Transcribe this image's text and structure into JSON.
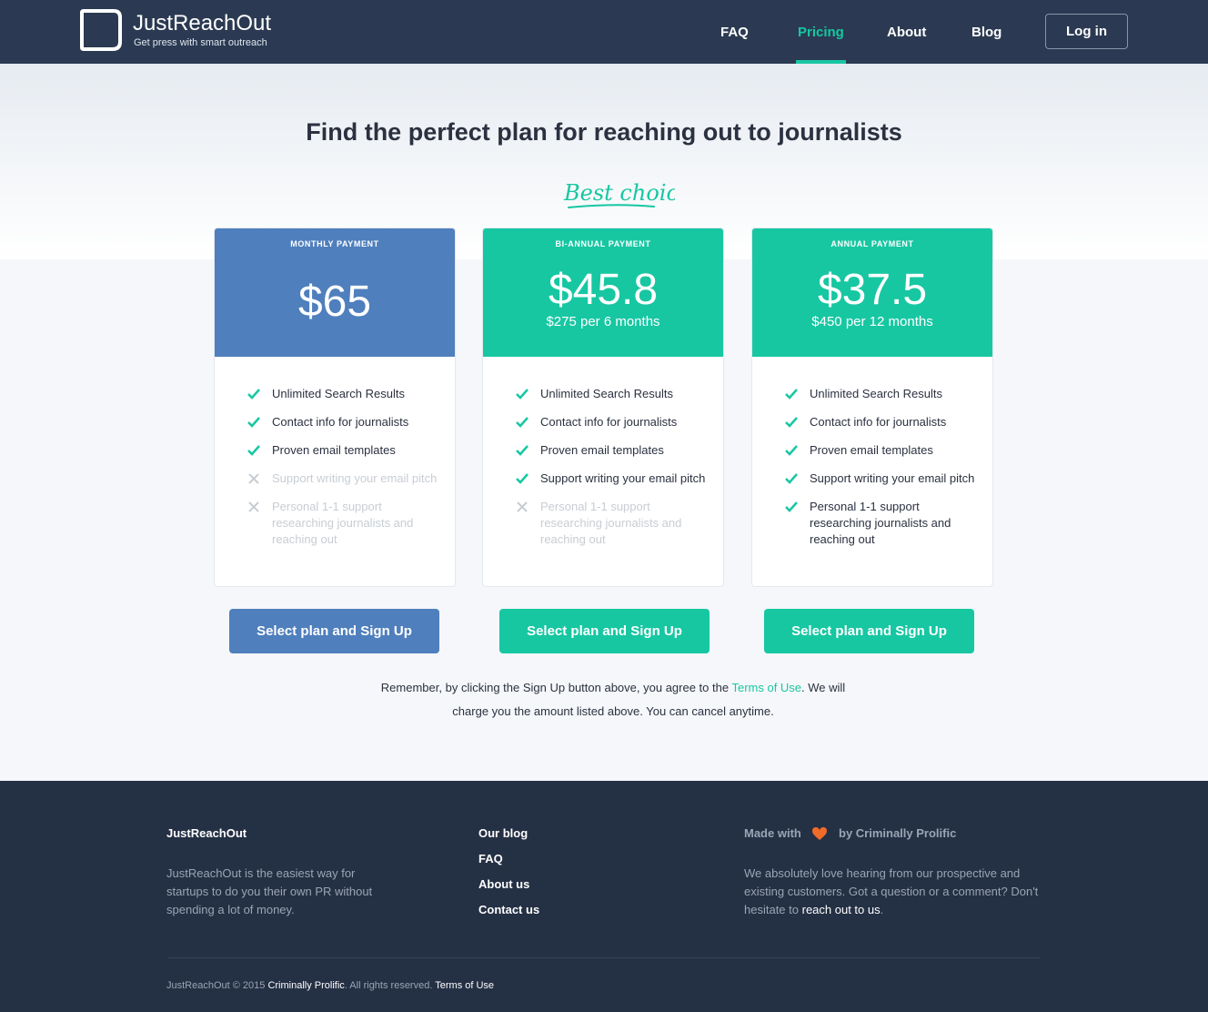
{
  "header": {
    "brand": "JustReachOut",
    "tagline": "Get press with smart outreach",
    "nav": [
      "FAQ",
      "Pricing",
      "About",
      "Blog"
    ],
    "active_nav": "Pricing",
    "login": "Log in"
  },
  "hero": {
    "headline": "Find the perfect plan for reaching out to journalists",
    "best_choice": "Best choice!"
  },
  "plans": [
    {
      "name": "MONTHLY PAYMENT",
      "price": "$65",
      "subprice": "",
      "color": "#4F7FBD",
      "features": [
        {
          "text": "Unlimited Search Results",
          "included": true
        },
        {
          "text": "Contact info for journalists",
          "included": true
        },
        {
          "text": "Proven email templates",
          "included": true
        },
        {
          "text": "Support writing your email pitch",
          "included": false
        },
        {
          "text": "Personal 1-1 support researching journalists and reaching out",
          "included": false
        }
      ],
      "button": "Select plan and Sign Up"
    },
    {
      "name": "BI-ANNUAL PAYMENT",
      "price": "$45.8",
      "subprice": "$275 per 6 months",
      "color": "#17C7A2",
      "features": [
        {
          "text": "Unlimited Search Results",
          "included": true
        },
        {
          "text": "Contact info for journalists",
          "included": true
        },
        {
          "text": "Proven email templates",
          "included": true
        },
        {
          "text": "Support writing your email pitch",
          "included": true
        },
        {
          "text": "Personal 1-1 support researching journalists and reaching out",
          "included": false
        }
      ],
      "button": "Select plan and Sign Up"
    },
    {
      "name": "ANNUAL PAYMENT",
      "price": "$37.5",
      "subprice": "$450 per 12 months",
      "color": "#17C7A2",
      "features": [
        {
          "text": "Unlimited Search Results",
          "included": true
        },
        {
          "text": "Contact info for journalists",
          "included": true
        },
        {
          "text": "Proven email templates",
          "included": true
        },
        {
          "text": "Support writing your email pitch",
          "included": true
        },
        {
          "text": "Personal 1-1 support researching journalists and reaching out",
          "included": true
        }
      ],
      "button": "Select plan and Sign Up"
    }
  ],
  "note": {
    "before": "Remember, by clicking the Sign Up button above, you agree to the ",
    "link": "Terms of Use",
    "after": ". We will charge you the amount listed above. You can cancel anytime."
  },
  "footer": {
    "title": "JustReachOut",
    "description": "JustReachOut is the easiest way for startups to do you their own PR without spending a lot of money.",
    "links": [
      "Our blog",
      "FAQ",
      "About us",
      "Contact us"
    ],
    "made_with": "Made with",
    "by": "by Criminally Prolific",
    "contact_text": "We absolutely love hearing from our prospective and existing customers. Got a question or a comment? Don't hesitate to ",
    "contact_link": "reach out to us",
    "contact_end": ".",
    "copyright_prefix": "JustReachOut © 2015 ",
    "copyright_company": "Criminally Prolific",
    "copyright_mid": ". All rights reserved. ",
    "copyright_terms": "Terms of Use"
  },
  "colors": {
    "accent": "#17C7A2",
    "blue": "#4F7FBD",
    "header": "#2B3A52",
    "footer": "#243044",
    "heart": "#F06A2A"
  },
  "icons": {
    "logo": "speech-bubble-icon",
    "included": "checkmark-icon",
    "excluded": "x-icon",
    "heart": "heart-icon"
  }
}
